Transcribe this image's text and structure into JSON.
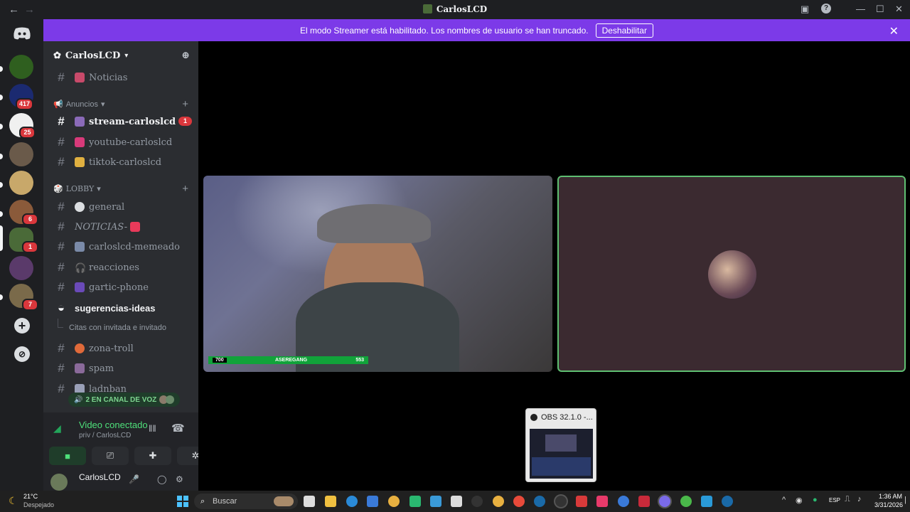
{
  "window": {
    "title": "CarlosLCD",
    "back": "←",
    "forward": "→"
  },
  "banner": {
    "text": "El modo Streamer está habilitado. Los nombres de usuario se han truncado.",
    "button": "Deshabilitar"
  },
  "servers": {
    "badges": [
      "417",
      "25",
      "6",
      "1",
      "7"
    ]
  },
  "guild": {
    "name": "CarlosLCD"
  },
  "channels": {
    "top": "Noticias",
    "cat1": "Anuncios",
    "stream": "stream-carloslcd",
    "stream_badge": "1",
    "youtube": "youtube-carloslcd",
    "tiktok": "tiktok-carloslcd",
    "cat2": "LOBBY",
    "general": "general",
    "noticias2": "NOTICIAS-",
    "memeado": "carloslcd-memeado",
    "reacciones": "reacciones",
    "gartic": "gartic-phone",
    "sugerencias": "sugerencias-ideas",
    "thread": "Citas con invitada e invitado",
    "zona": "zona-troll",
    "spam": "spam",
    "last": "ladnban"
  },
  "voice_pill": "2 EN CANAL DE VOZ",
  "vc": {
    "status": "Video conectado",
    "sub": "priv / CarlosLCD"
  },
  "user": {
    "name": "CarlosLCD"
  },
  "cam_overlay": {
    "left": "700",
    "mid": "ASEREGANG",
    "right": "553"
  },
  "popup": {
    "title": "OBS 32.1.0 -..."
  },
  "taskbar": {
    "temp": "21°C",
    "weather": "Despejado",
    "search": "Buscar",
    "lang": "ESP",
    "time": "1:36 AM",
    "date": "3/31/2026"
  }
}
